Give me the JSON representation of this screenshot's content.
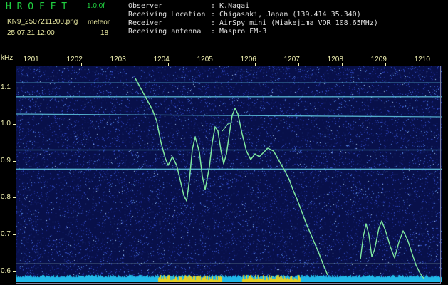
{
  "header": {
    "logo_text": "H R O F F T",
    "version": "1.0.0f",
    "filename": "KN9_2507211200.png",
    "meteor_label": "meteor",
    "datetime": "25.07.21 12:00",
    "meteor_count": "18",
    "info": [
      {
        "label": "Observer",
        "value": ": K.Nagai"
      },
      {
        "label": "Receiving Location",
        "value": ": Chigasaki, Japan (139.414 35.340)"
      },
      {
        "label": "Receiver",
        "value": ": AirSpy mini (Miakejima VOR 108.65MHz)"
      },
      {
        "label": "Receiving antenna",
        "value": ": Maspro FM-3"
      }
    ]
  },
  "axes": {
    "y_unit": "kHz",
    "x_ticks": [
      "1201",
      "1202",
      "1203",
      "1204",
      "1205",
      "1206",
      "1207",
      "1208",
      "1209",
      "1210"
    ],
    "y_ticks": [
      "1.1",
      "1.0",
      "0.9",
      "0.8",
      "0.7",
      "0.6"
    ]
  },
  "colors": {
    "background": "#000000",
    "plot_background": "#08104a",
    "signal": "#7fe8a0",
    "carrier": "#60c8e0",
    "bottom_strip": "#20b8e8",
    "bottom_strip_yellow": "#e8d020",
    "header_text": "#e8e8a0"
  },
  "chart_data": {
    "type": "heatmap",
    "x_range": [
      1200.5,
      1210.3
    ],
    "y_range": [
      0.57,
      1.16
    ],
    "carriers_khz": [
      1.113,
      1.075,
      1.028,
      0.93,
      0.878,
      0.62,
      0.6
    ]
  }
}
